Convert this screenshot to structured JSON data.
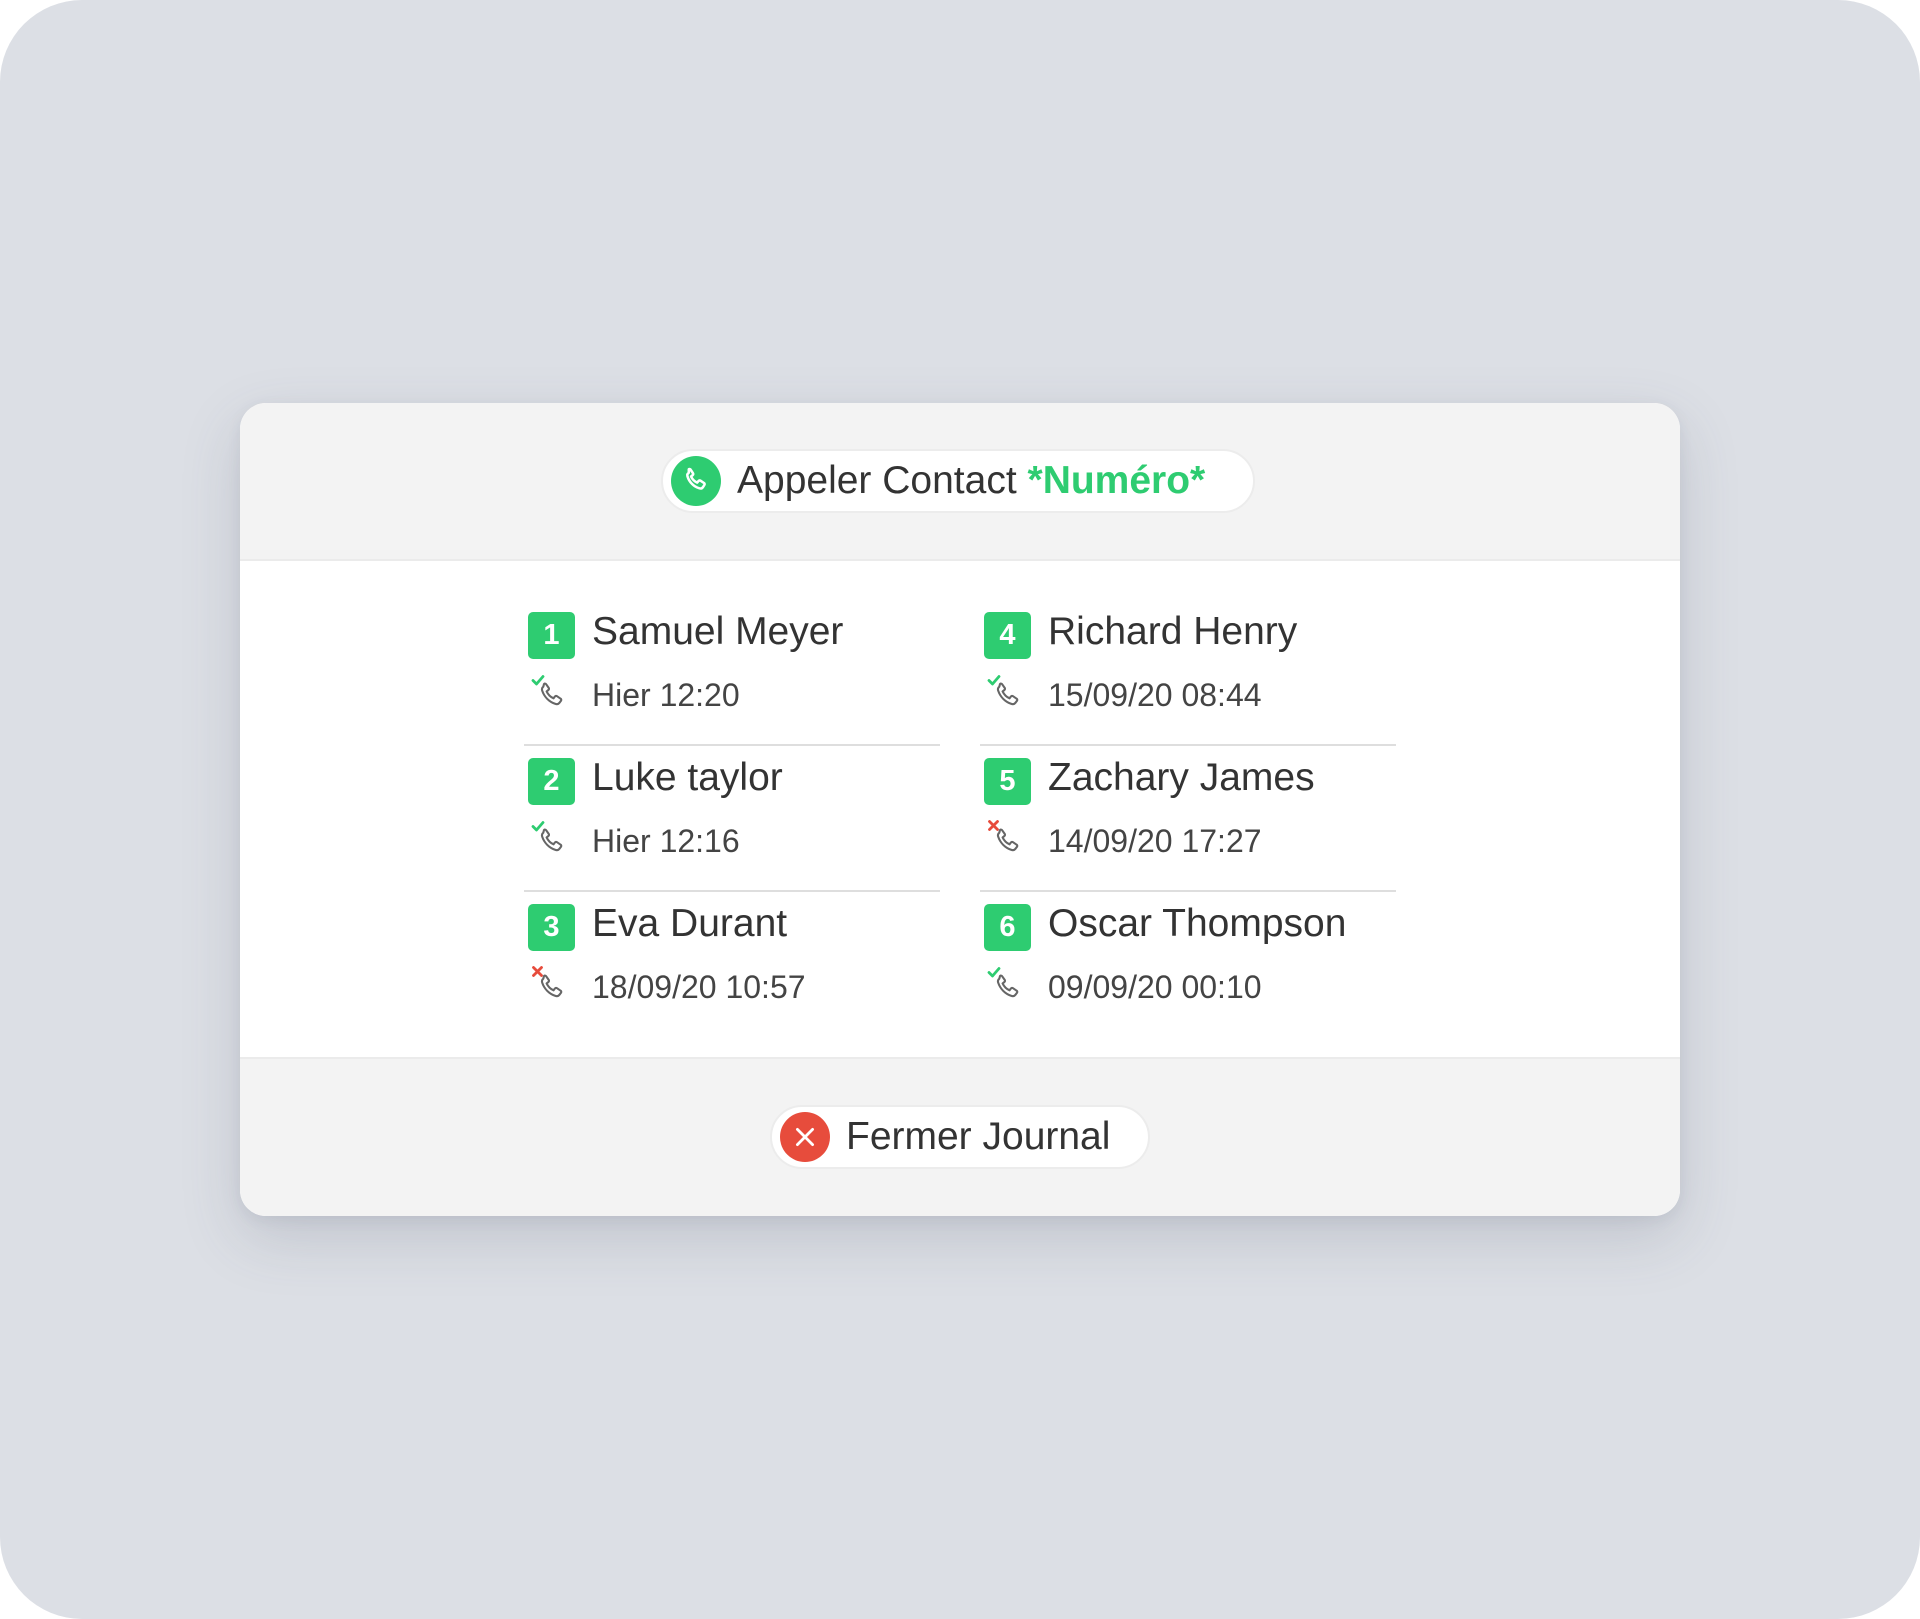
{
  "colors": {
    "accent_green": "#2ecc71",
    "close_red": "#e74c3c",
    "backdrop": "#dcdfe5",
    "panel_band": "#f3f3f3"
  },
  "header": {
    "call_button": {
      "label": "Appeler Contact",
      "highlight": "*Numéro*",
      "icon": "phone-icon"
    }
  },
  "call_log": {
    "entries": [
      {
        "index": "1",
        "name": "Samuel Meyer",
        "time": "Hier 12:20",
        "status": "answered",
        "status_icon": "call-answered-icon"
      },
      {
        "index": "2",
        "name": "Luke taylor",
        "time": "Hier 12:16",
        "status": "answered",
        "status_icon": "call-answered-icon"
      },
      {
        "index": "3",
        "name": "Eva Durant",
        "time": "18/09/20 10:57",
        "status": "missed",
        "status_icon": "call-missed-icon"
      },
      {
        "index": "4",
        "name": "Richard Henry",
        "time": "15/09/20 08:44",
        "status": "answered",
        "status_icon": "call-answered-icon"
      },
      {
        "index": "5",
        "name": "Zachary James",
        "time": "14/09/20 17:27",
        "status": "missed",
        "status_icon": "call-missed-icon"
      },
      {
        "index": "6",
        "name": "Oscar Thompson",
        "time": "09/09/20 00:10",
        "status": "answered",
        "status_icon": "call-answered-icon"
      }
    ]
  },
  "footer": {
    "close_button": {
      "label": "Fermer Journal",
      "icon": "close-icon"
    }
  }
}
